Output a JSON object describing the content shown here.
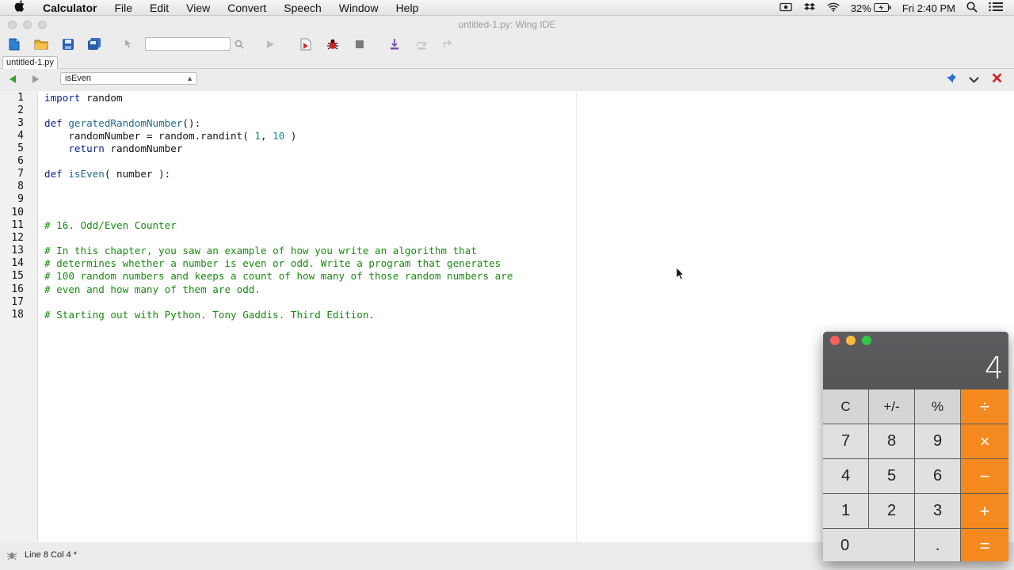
{
  "menubar": {
    "app": "Calculator",
    "items": [
      "File",
      "Edit",
      "View",
      "Convert",
      "Speech",
      "Window",
      "Help"
    ],
    "battery": "32%",
    "clock": "Fri 2:40 PM"
  },
  "window": {
    "title": "untitled-1.py: Wing IDE"
  },
  "tab": {
    "label": "untitled-1.py"
  },
  "nav": {
    "symbol": "isEven"
  },
  "editor": {
    "line_numbers": [
      "1",
      "2",
      "3",
      "4",
      "5",
      "6",
      "7",
      "8",
      "9",
      "10",
      "11",
      "12",
      "13",
      "14",
      "15",
      "16",
      "17",
      "18"
    ],
    "lines": {
      "l1_kw": "import",
      "l1_rest": " random",
      "l3_kw": "def",
      "l3_fn": "geratedRandomNumber",
      "l3_rest": "():",
      "l4_a": "    randomNumber = random.randint( ",
      "l4_n1": "1",
      "l4_b": ", ",
      "l4_n2": "10",
      "l4_c": " )",
      "l5_kw": "    return",
      "l5_rest": " randomNumber",
      "l7_kw": "def",
      "l7_fn": "isEven",
      "l7_rest": "( number ):",
      "l11": "# 16. Odd/Even Counter",
      "l13": "# In this chapter, you saw an example of how you write an algorithm that",
      "l14": "# determines whether a number is even or odd. Write a program that generates",
      "l15": "# 100 random numbers and keeps a count of how many of those random numbers are",
      "l16": "# even and how many of them are odd.",
      "l18": "# Starting out with Python. Tony Gaddis. Third Edition."
    }
  },
  "status": {
    "text": "Line 8 Col 4 *"
  },
  "calculator": {
    "display": "4",
    "keys": {
      "clear": "C",
      "sign": "+/-",
      "percent": "%",
      "divide": "÷",
      "multiply": "×",
      "minus": "−",
      "plus": "+",
      "equals": "=",
      "dot": ".",
      "d0": "0",
      "d1": "1",
      "d2": "2",
      "d3": "3",
      "d4": "4",
      "d5": "5",
      "d6": "6",
      "d7": "7",
      "d8": "8",
      "d9": "9"
    },
    "colors": {
      "operator": "#f48a1f",
      "close": "#fc605c",
      "minimize": "#fdbc40",
      "zoom": "#34c84a"
    }
  }
}
